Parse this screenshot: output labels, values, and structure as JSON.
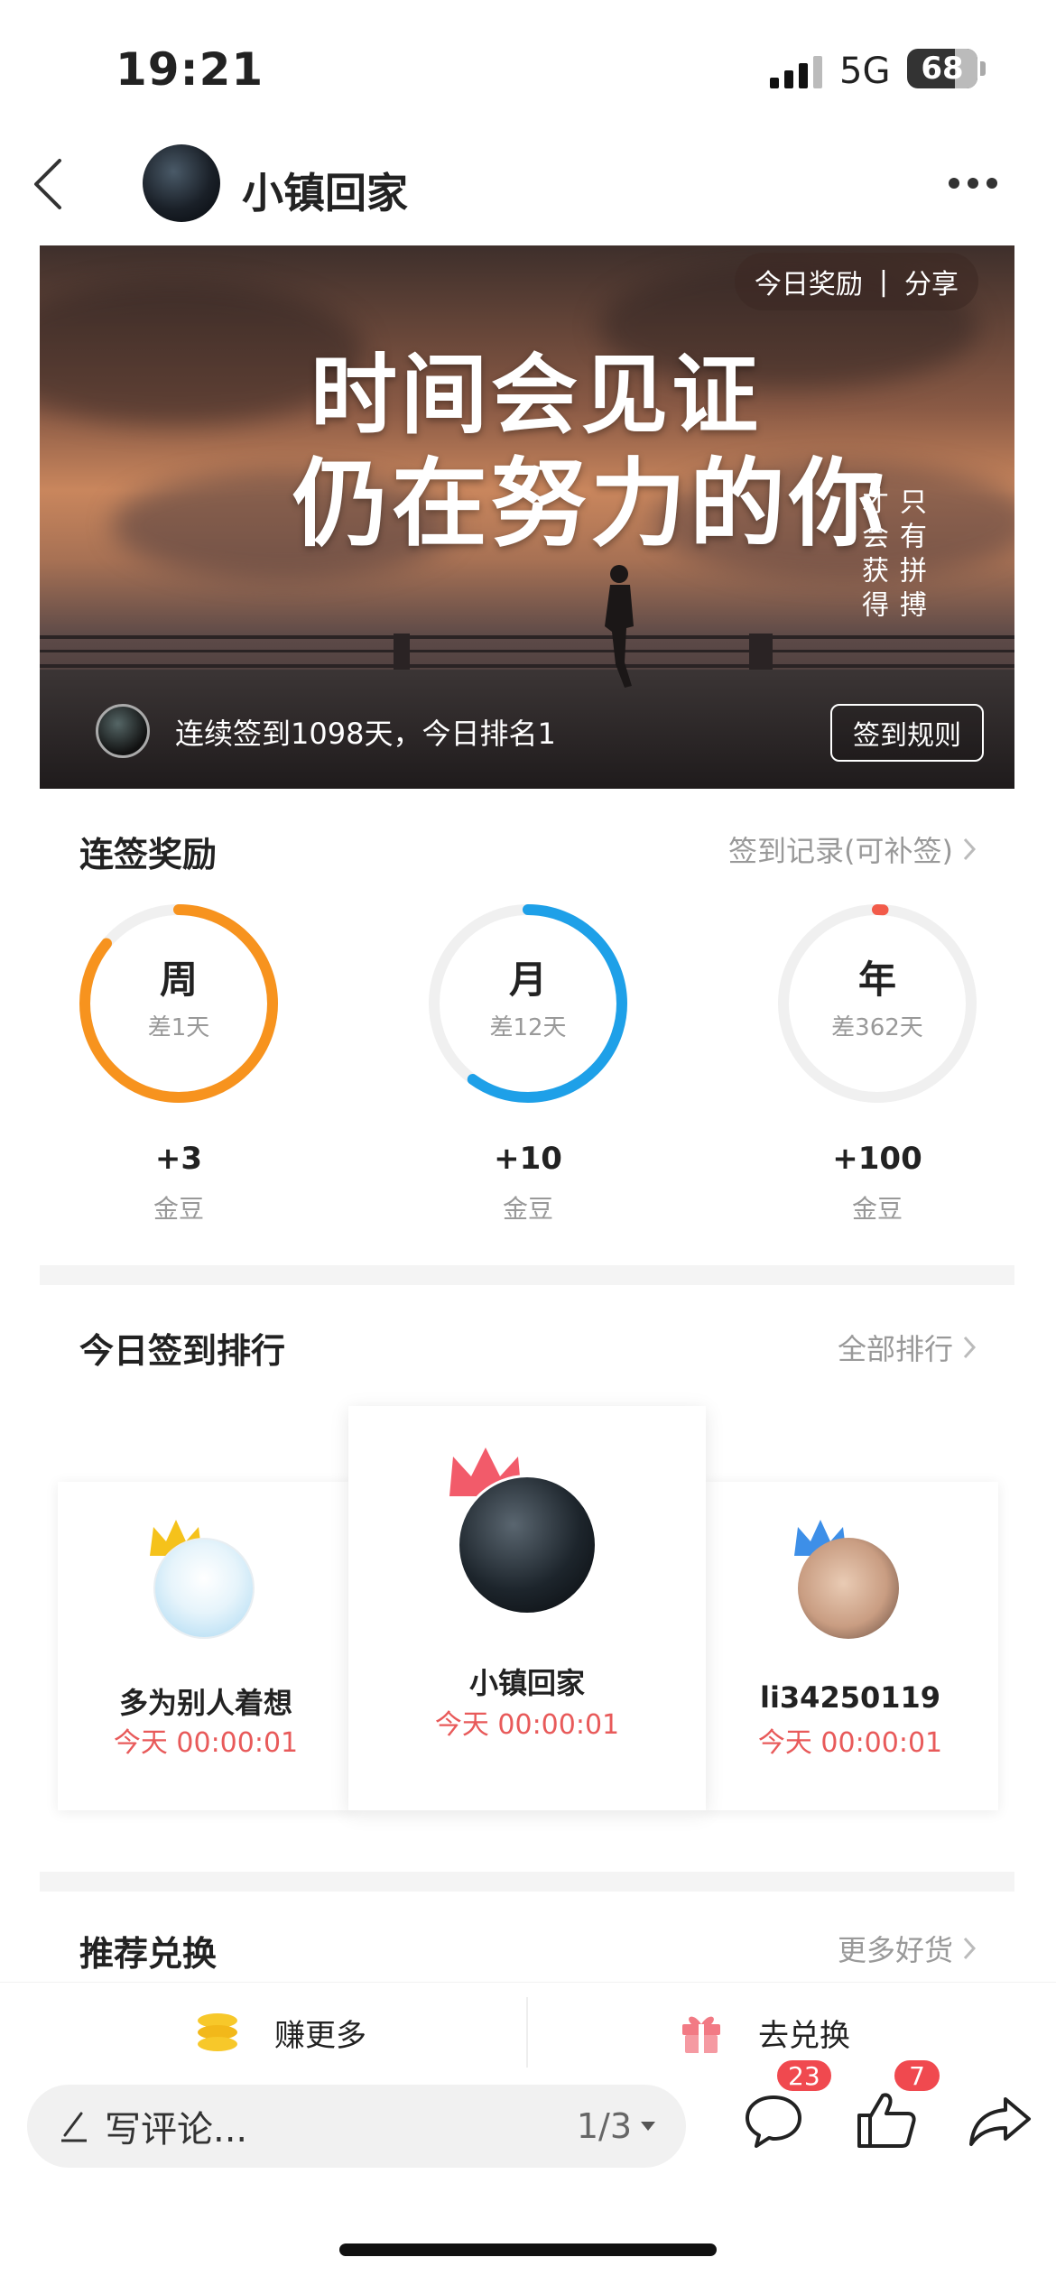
{
  "status_bar": {
    "time": "19:21",
    "network": "5G",
    "battery": "68"
  },
  "nav": {
    "title": "小镇回家"
  },
  "banner": {
    "today_reward": "今日奖励",
    "separator": "|",
    "share": "分享",
    "headline_1": "时间会见证",
    "headline_2": "仍在努力的你",
    "vertical_left": "才会获得",
    "vertical_right": "只有拼搏",
    "checkin_text": "连续签到1098天，今日排名1",
    "rules_button": "签到规则"
  },
  "streak": {
    "title": "连签奖励",
    "record_link": "签到记录(可补签)",
    "items": [
      {
        "label": "周",
        "remaining": "差1天",
        "points": "+3",
        "unit": "金豆",
        "progress": 0.86,
        "color": "#f7931e"
      },
      {
        "label": "月",
        "remaining": "差12天",
        "points": "+10",
        "unit": "金豆",
        "progress": 0.6,
        "color": "#1ea0e8"
      },
      {
        "label": "年",
        "remaining": "差362天",
        "points": "+100",
        "unit": "金豆",
        "progress": 0.01,
        "color": "#f25b4a"
      }
    ]
  },
  "ranking": {
    "title": "今日签到排行",
    "all_link": "全部排行",
    "entries": [
      {
        "name": "小镇回家",
        "time": "今天 00:00:01",
        "crown_color": "#f25b6a"
      },
      {
        "name": "多为别人着想",
        "time": "今天 00:00:01",
        "crown_color": "#f5c21b"
      },
      {
        "name": "li34250119",
        "time": "今天 00:00:01",
        "crown_color": "#3d8fe8"
      }
    ]
  },
  "recommend": {
    "title": "推荐兑换",
    "more_link": "更多好货"
  },
  "actions": {
    "earn_more": "赚更多",
    "redeem": "去兑换"
  },
  "comment": {
    "placeholder": "写评论...",
    "page_indicator": "1/3"
  },
  "badges": {
    "comments": "23",
    "likes": "7"
  }
}
